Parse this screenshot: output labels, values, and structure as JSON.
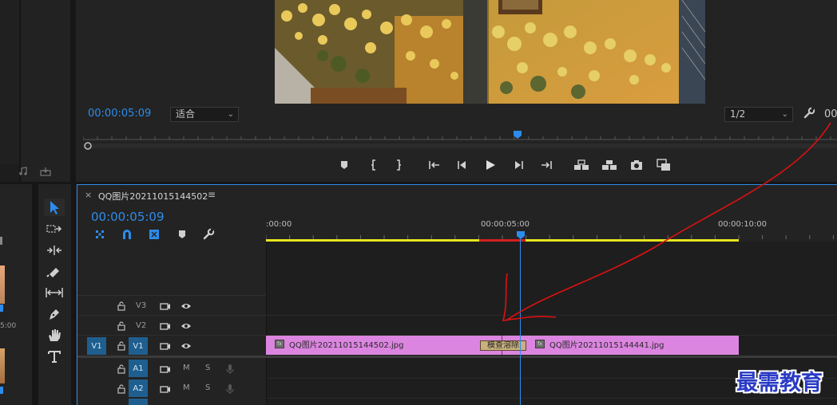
{
  "program": {
    "timecode": "00:00:05:09",
    "fit_label": "适合",
    "resolution_label": "1/2",
    "right_timecode": "00"
  },
  "sequence": {
    "close": "×",
    "name": "QQ图片20211015144502",
    "menu": "≡",
    "timecode": "00:00:05:09",
    "ruler_labels": [
      ":00:00",
      "00:00:05:00",
      "00:00:10:00"
    ]
  },
  "tracks": {
    "v3": "V3",
    "v2": "V2",
    "v1": "V1",
    "v1_target": "V1",
    "a1": "A1",
    "a2": "A2",
    "mute": "M",
    "solo": "S"
  },
  "clips": {
    "clip1": "QQ图片20211015144502.jpg",
    "clip2": "QQ图片20211015144441.jpg",
    "transition": "模查溶除",
    "fx": "fx"
  },
  "left_panel": {
    "time_fragment": "5:00"
  },
  "watermark": "最需教育",
  "colors": {
    "accent": "#2d8ceb",
    "clip": "#dc85e0",
    "workarea": "#e5e51e",
    "annotation": "#e01010"
  }
}
